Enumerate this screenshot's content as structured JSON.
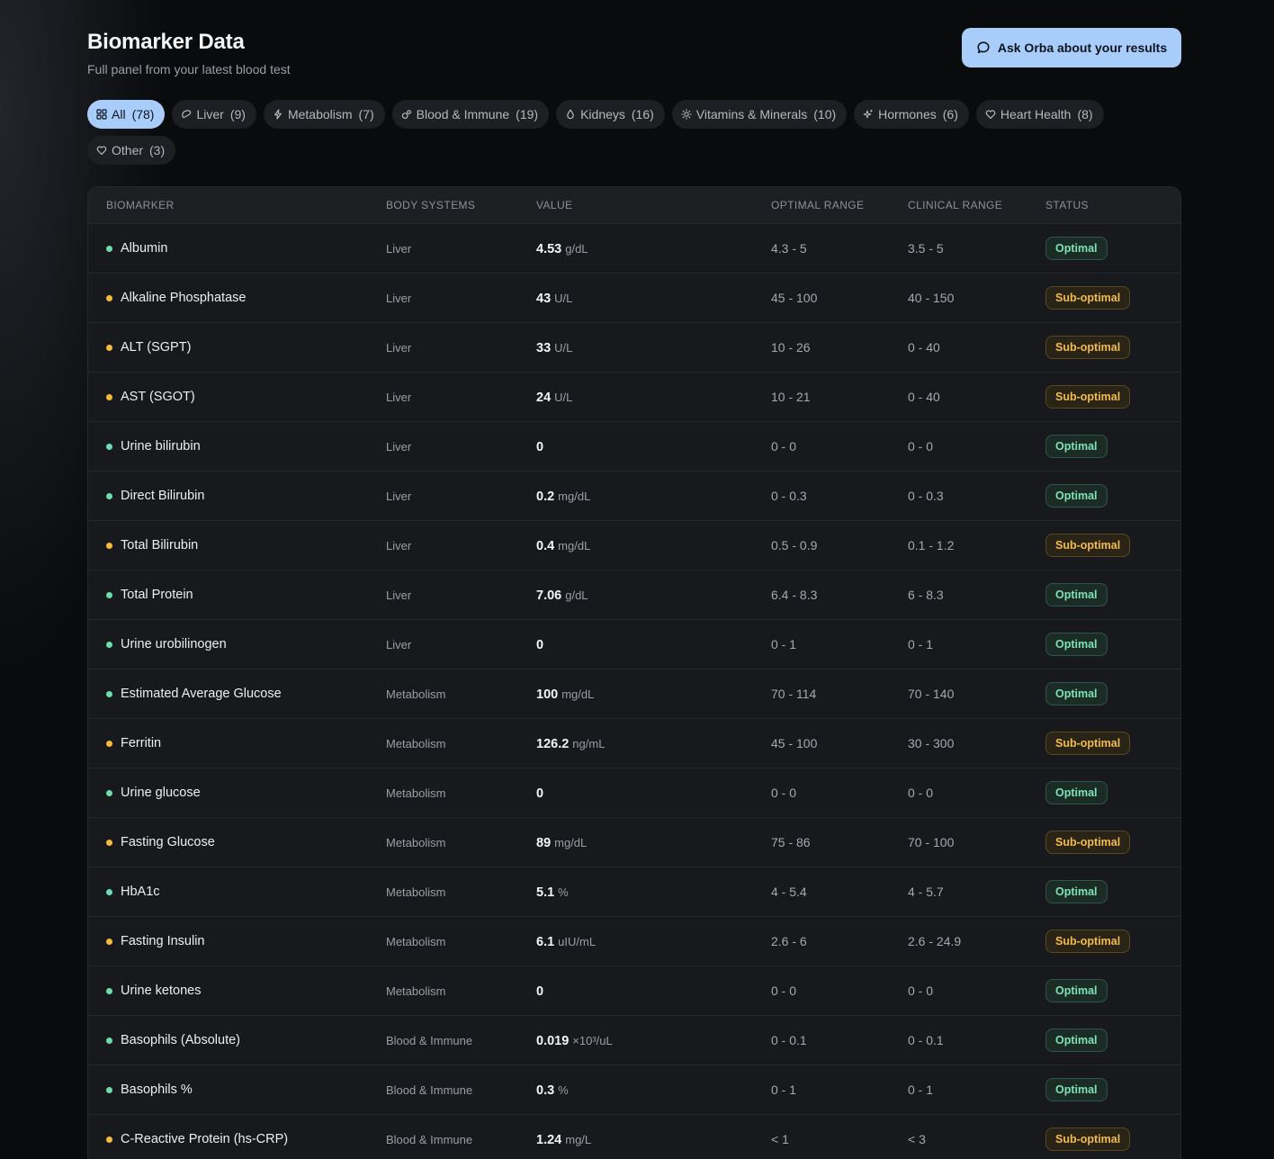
{
  "header": {
    "title": "Biomarker Data",
    "subtitle": "Full panel from your latest blood test",
    "ask_button_label": "Ask Orba about your results"
  },
  "filters": [
    {
      "label": "All",
      "count": "(78)",
      "icon": "grid-icon",
      "active": true
    },
    {
      "label": "Liver",
      "count": "(9)",
      "icon": "liver-icon",
      "active": false
    },
    {
      "label": "Metabolism",
      "count": "(7)",
      "icon": "bolt-icon",
      "active": false
    },
    {
      "label": "Blood & Immune",
      "count": "(19)",
      "icon": "blood-cells-icon",
      "active": false
    },
    {
      "label": "Kidneys",
      "count": "(16)",
      "icon": "droplet-icon",
      "active": false
    },
    {
      "label": "Vitamins & Minerals",
      "count": "(10)",
      "icon": "sun-icon",
      "active": false
    },
    {
      "label": "Hormones",
      "count": "(6)",
      "icon": "sparkle-icon",
      "active": false
    },
    {
      "label": "Heart Health",
      "count": "(8)",
      "icon": "heart-icon",
      "active": false
    },
    {
      "label": "Other",
      "count": "(3)",
      "icon": "heart-icon",
      "active": false
    }
  ],
  "table": {
    "columns": {
      "biomarker": "Biomarker",
      "systems": "Body Systems",
      "value": "Value",
      "optimal": "Optimal Range",
      "clinical": "Clinical Range",
      "status": "Status"
    },
    "rows": [
      {
        "name": "Albumin",
        "system": "Liver",
        "value": "4.53",
        "unit": "g/dL",
        "optimal": "4.3 - 5",
        "clinical": "3.5 - 5",
        "status": "Optimal",
        "state": "opt"
      },
      {
        "name": "Alkaline Phosphatase",
        "system": "Liver",
        "value": "43",
        "unit": "U/L",
        "optimal": "45 - 100",
        "clinical": "40 - 150",
        "status": "Sub-optimal",
        "state": "sub"
      },
      {
        "name": "ALT (SGPT)",
        "system": "Liver",
        "value": "33",
        "unit": "U/L",
        "optimal": "10 - 26",
        "clinical": "0 - 40",
        "status": "Sub-optimal",
        "state": "sub"
      },
      {
        "name": "AST (SGOT)",
        "system": "Liver",
        "value": "24",
        "unit": "U/L",
        "optimal": "10 - 21",
        "clinical": "0 - 40",
        "status": "Sub-optimal",
        "state": "sub"
      },
      {
        "name": "Urine bilirubin",
        "system": "Liver",
        "value": "0",
        "unit": "",
        "optimal": "0 - 0",
        "clinical": "0 - 0",
        "status": "Optimal",
        "state": "opt"
      },
      {
        "name": "Direct Bilirubin",
        "system": "Liver",
        "value": "0.2",
        "unit": "mg/dL",
        "optimal": "0 - 0.3",
        "clinical": "0 - 0.3",
        "status": "Optimal",
        "state": "opt"
      },
      {
        "name": "Total Bilirubin",
        "system": "Liver",
        "value": "0.4",
        "unit": "mg/dL",
        "optimal": "0.5 - 0.9",
        "clinical": "0.1 - 1.2",
        "status": "Sub-optimal",
        "state": "sub"
      },
      {
        "name": "Total Protein",
        "system": "Liver",
        "value": "7.06",
        "unit": "g/dL",
        "optimal": "6.4 - 8.3",
        "clinical": "6 - 8.3",
        "status": "Optimal",
        "state": "opt"
      },
      {
        "name": "Urine urobilinogen",
        "system": "Liver",
        "value": "0",
        "unit": "",
        "optimal": "0 - 1",
        "clinical": "0 - 1",
        "status": "Optimal",
        "state": "opt"
      },
      {
        "name": "Estimated Average Glucose",
        "system": "Metabolism",
        "value": "100",
        "unit": "mg/dL",
        "optimal": "70 - 114",
        "clinical": "70 - 140",
        "status": "Optimal",
        "state": "opt"
      },
      {
        "name": "Ferritin",
        "system": "Metabolism",
        "value": "126.2",
        "unit": "ng/mL",
        "optimal": "45 - 100",
        "clinical": "30 - 300",
        "status": "Sub-optimal",
        "state": "sub"
      },
      {
        "name": "Urine glucose",
        "system": "Metabolism",
        "value": "0",
        "unit": "",
        "optimal": "0 - 0",
        "clinical": "0 - 0",
        "status": "Optimal",
        "state": "opt"
      },
      {
        "name": "Fasting Glucose",
        "system": "Metabolism",
        "value": "89",
        "unit": "mg/dL",
        "optimal": "75 - 86",
        "clinical": "70 - 100",
        "status": "Sub-optimal",
        "state": "sub"
      },
      {
        "name": "HbA1c",
        "system": "Metabolism",
        "value": "5.1",
        "unit": "%",
        "optimal": "4 - 5.4",
        "clinical": "4 - 5.7",
        "status": "Optimal",
        "state": "opt"
      },
      {
        "name": "Fasting Insulin",
        "system": "Metabolism",
        "value": "6.1",
        "unit": "uIU/mL",
        "optimal": "2.6 - 6",
        "clinical": "2.6 - 24.9",
        "status": "Sub-optimal",
        "state": "sub"
      },
      {
        "name": "Urine ketones",
        "system": "Metabolism",
        "value": "0",
        "unit": "",
        "optimal": "0 - 0",
        "clinical": "0 - 0",
        "status": "Optimal",
        "state": "opt"
      },
      {
        "name": "Basophils (Absolute)",
        "system": "Blood & Immune",
        "value": "0.019",
        "unit": "×10³/uL",
        "optimal": "0 - 0.1",
        "clinical": "0 - 0.1",
        "status": "Optimal",
        "state": "opt"
      },
      {
        "name": "Basophils %",
        "system": "Blood & Immune",
        "value": "0.3",
        "unit": "%",
        "optimal": "0 - 1",
        "clinical": "0 - 1",
        "status": "Optimal",
        "state": "opt"
      },
      {
        "name": "C-Reactive Protein (hs-CRP)",
        "system": "Blood & Immune",
        "value": "1.24",
        "unit": "mg/L",
        "optimal": "< 1",
        "clinical": "< 3",
        "status": "Sub-optimal",
        "state": "sub"
      }
    ]
  }
}
